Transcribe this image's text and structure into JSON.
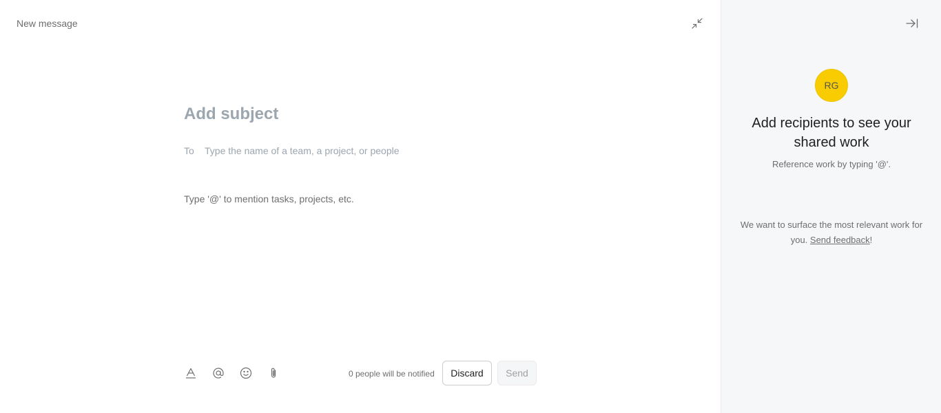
{
  "composer": {
    "title": "New message",
    "subject_placeholder": "Add subject",
    "to_label": "To",
    "to_placeholder": "Type the name of a team, a project, or people",
    "body_placeholder": "Type '@' to mention tasks, projects, etc.",
    "toolbar": {
      "icons": [
        "text-format-icon",
        "mention-icon",
        "emoji-icon",
        "attachment-icon"
      ]
    },
    "notified_text": "0 people will be notified",
    "discard_label": "Discard",
    "send_label": "Send"
  },
  "side_panel": {
    "avatar_initials": "RG",
    "avatar_color": "#f8cc00",
    "heading": "Add recipients to see your shared work",
    "subheading": "Reference work by typing '@'.",
    "note_prefix": "We want to surface the most relevant work for you. ",
    "feedback_link": "Send feedback",
    "note_suffix": "!"
  }
}
